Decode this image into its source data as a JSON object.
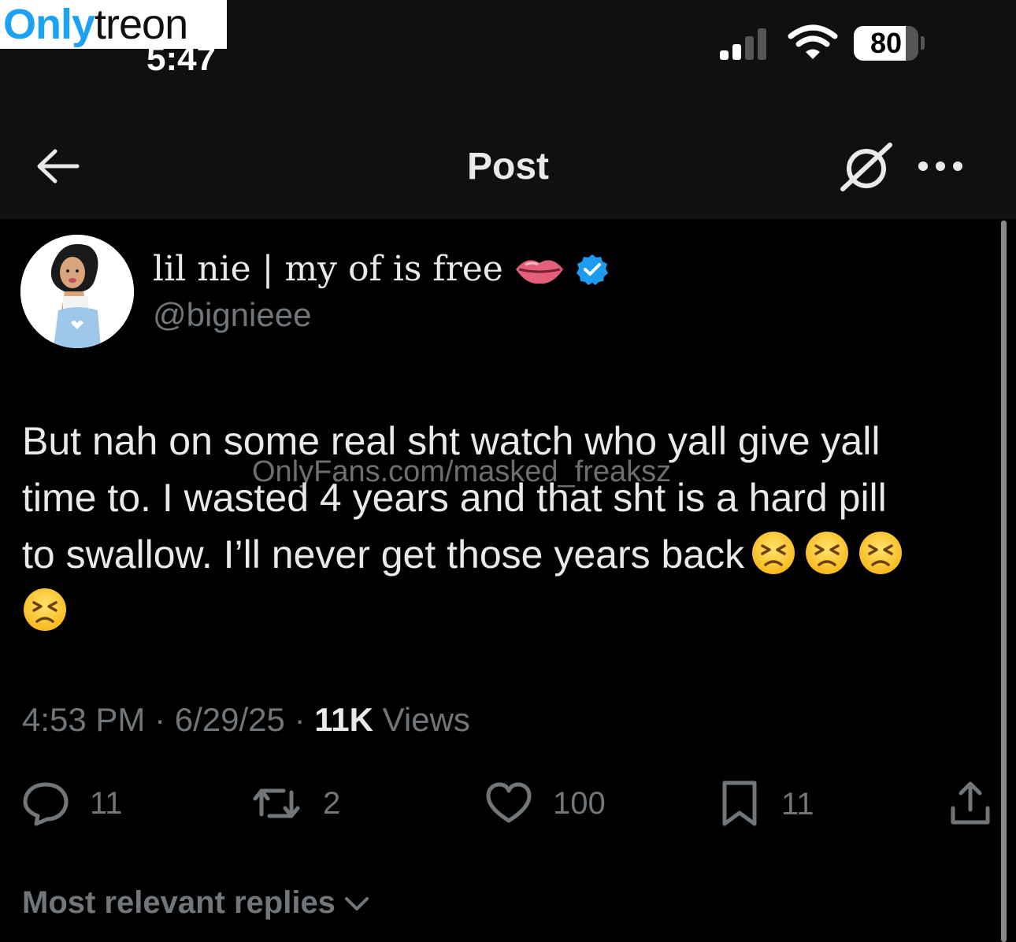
{
  "watermark": {
    "logo_a": "Only",
    "logo_b": "treon",
    "overlay": "OnlyFans.com/masked_freaksz"
  },
  "status_bar": {
    "time": "5:47",
    "battery": "80",
    "battery_level": 0.8
  },
  "header": {
    "title": "Post"
  },
  "author": {
    "display_name": "lil nie | my of is free",
    "handle": "@bignieee",
    "verified": true
  },
  "tweet": {
    "line1": "But nah on some real sht watch who yall give yall",
    "line2": "time to. I wasted 4 years and that sht is a hard pill",
    "line3": "to swallow. I’ll never get those years back",
    "emoji": "persevering-face"
  },
  "meta": {
    "time": "4:53 PM",
    "date": "6/29/25",
    "views_count": "11K",
    "views_label": "Views"
  },
  "actions": {
    "replies": "11",
    "reposts": "2",
    "likes": "100",
    "bookmarks": "11"
  },
  "replies_section": {
    "label": "Most relevant replies"
  },
  "colors": {
    "background": "#000000",
    "text": "#e7e9ea",
    "secondary": "#71767b",
    "verified": "#1d9bf0"
  }
}
